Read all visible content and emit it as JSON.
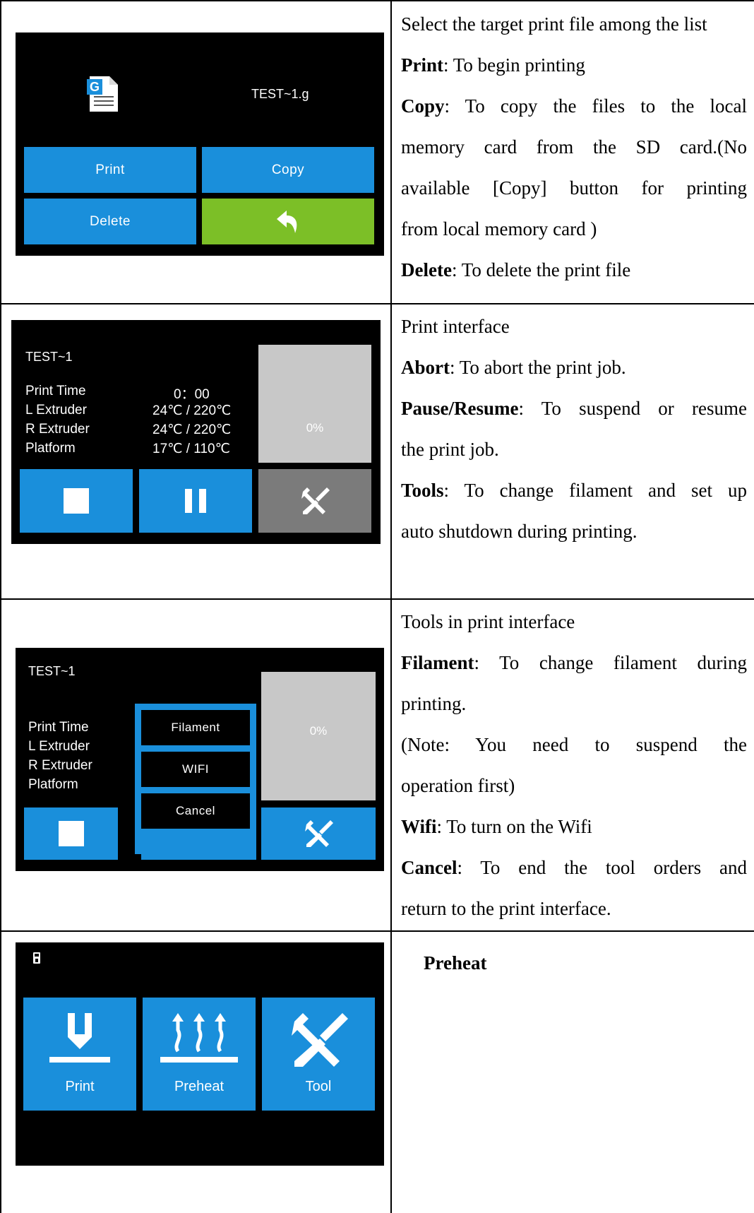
{
  "colors": {
    "accent_blue": "#1a8fdb",
    "back_green": "#7cbf27",
    "tool_gray": "#7b7b7b",
    "progress_panel": "#c8c8c8",
    "screen_bg": "#000000"
  },
  "row1": {
    "screen": {
      "file_icon_letter": "G",
      "file_name": "TEST~1.g",
      "print_label": "Print",
      "copy_label": "Copy",
      "delete_label": "Delete",
      "back_icon": "return-arrow-icon"
    },
    "desc": {
      "line1": "Select the target print file among the list",
      "print_term": "Print",
      "print_text": ": To begin printing",
      "copy_term": "Copy",
      "copy_text_1": ": To copy the files to the local",
      "copy_text_2": "memory card from the SD card.(No",
      "copy_text_3": "available [Copy] button for printing",
      "copy_text_4": "from local memory card )",
      "delete_term": "Delete",
      "delete_text": ": To delete the print file"
    }
  },
  "row2": {
    "screen": {
      "file_name": "TEST~1",
      "labels": [
        "Print Time",
        "L Extruder",
        "R Extruder",
        "Platform"
      ],
      "values": [
        "0：00",
        "24℃ / 220℃",
        "24℃ / 220℃",
        "17℃ / 110℃"
      ],
      "progress": "0%",
      "stop_icon": "stop-icon",
      "pause_icon": "pause-icon",
      "tools_icon": "tools-icon"
    },
    "desc": {
      "line1": "Print interface",
      "abort_term": "Abort",
      "abort_text": ": To abort the print job.",
      "pause_term": "Pause/Resume",
      "pause_text_1": ": To suspend or resume",
      "pause_text_2": "the print job.",
      "tools_term": "Tools",
      "tools_text_1": ": To change filament and set up",
      "tools_text_2": "auto shutdown during printing."
    }
  },
  "row3": {
    "screen": {
      "file_name": "TEST~1",
      "labels": [
        "Print Time",
        "L Extruder",
        "R Extruder",
        "Platform"
      ],
      "progress": "0%",
      "menu": [
        "Filament",
        "WIFI",
        "Cancel"
      ]
    },
    "desc": {
      "line1": "Tools in print interface",
      "filament_term": "Filament",
      "filament_text_1": ": To change filament during",
      "filament_text_2": "printing.",
      "note_1": "(Note: You need to suspend the",
      "note_2": "operation first)",
      "wifi_term": "Wifi",
      "wifi_text": ": To turn on the Wifi",
      "cancel_term": "Cancel",
      "cancel_text_1": ": To end the tool orders and",
      "cancel_text_2": "return to the print interface."
    }
  },
  "row4": {
    "screen": {
      "usb_icon": "usb-icon",
      "buttons": [
        "Print",
        "Preheat",
        "Tool"
      ]
    },
    "desc": {
      "title": "Preheat"
    }
  }
}
